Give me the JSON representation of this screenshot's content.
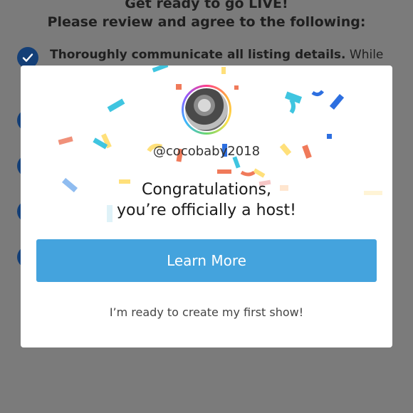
{
  "background": {
    "header_line1": "Get ready to go LIVE!",
    "header_line2": "Please review and agree to the following:",
    "checklist": [
      {
        "bold": "Thoroughly communicate all listing details.",
        "rest": " While"
      }
    ]
  },
  "modal": {
    "username": "@cocobaby2018",
    "congrats_line1": "Congratulations,",
    "congrats_line2": "you’re officially a host!",
    "primary_button": "Learn More",
    "secondary_link": "I’m ready to create my first show!"
  },
  "colors": {
    "overlay": "#7b7b7b",
    "button": "#44a3dd",
    "checkbox": "#143f77"
  },
  "icons": {
    "checkmark": "check-icon",
    "avatar": "profile-avatar"
  }
}
